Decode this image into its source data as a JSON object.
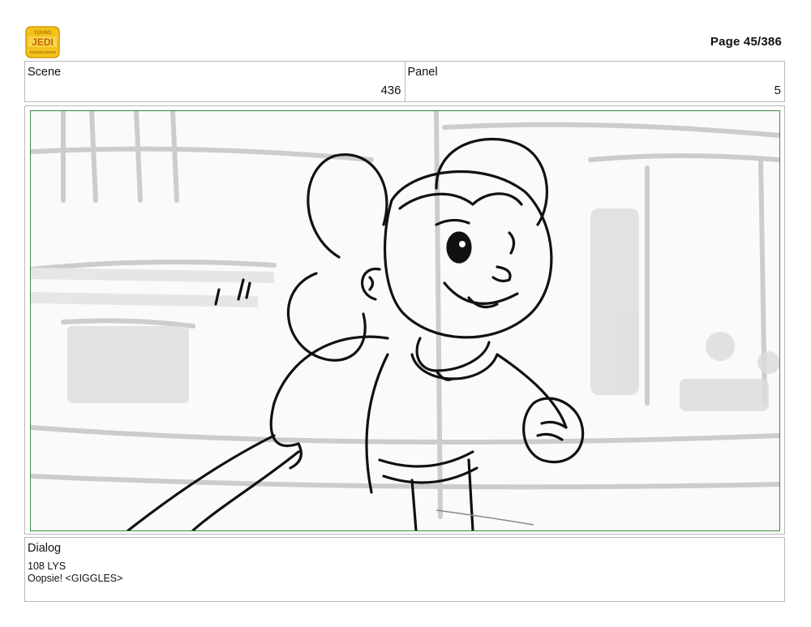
{
  "header": {
    "logo_text": "YOUNG JEDI ADVENTURES",
    "page_label": "Page 45/386"
  },
  "info": {
    "scene_label": "Scene",
    "scene_value": "436",
    "panel_label": "Panel",
    "panel_value": "5"
  },
  "dialog": {
    "label": "Dialog",
    "lines": [
      "108 LYS",
      "Oopsie! <GIGGLES>"
    ]
  },
  "colors": {
    "frame_border": "#b9b9b9",
    "panel_border": "#3a8a3a",
    "logo_gold": "#f2c21b"
  }
}
